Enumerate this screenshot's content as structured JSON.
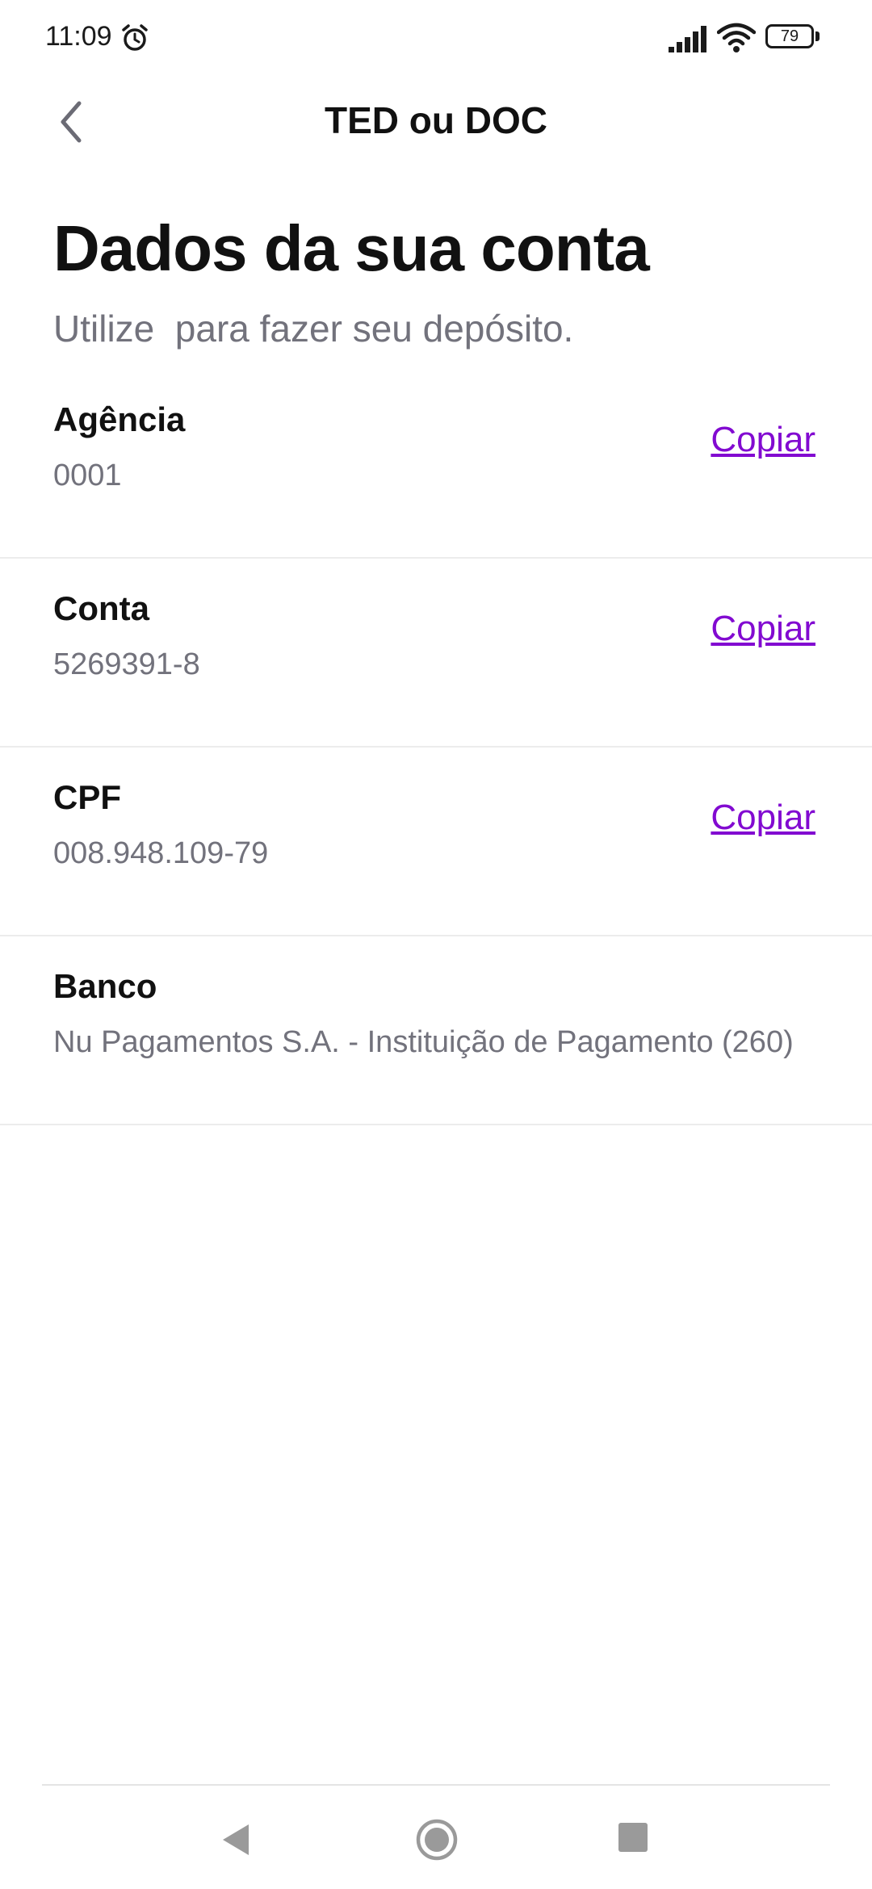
{
  "status_bar": {
    "time": "11:09",
    "battery_level": "79",
    "icons": [
      "alarm-icon",
      "signal-icon",
      "wifi-icon",
      "battery-icon"
    ]
  },
  "header": {
    "title": "TED ou DOC",
    "back_icon": "chevron-left-icon"
  },
  "main": {
    "title": "Dados da sua conta",
    "subtitle": "Utilize  para fazer seu depósito.",
    "copy_label": "Copiar",
    "rows": [
      {
        "label": "Agência",
        "value": "0001",
        "copyable": true
      },
      {
        "label": "Conta",
        "value": "5269391-8",
        "copyable": true
      },
      {
        "label": "CPF",
        "value": "008.948.109-79",
        "copyable": true
      },
      {
        "label": "Banco",
        "value": "Nu Pagamentos S.A. - Instituição de Pagamento (260)",
        "copyable": false
      }
    ]
  },
  "nav_bar": {
    "icons": [
      "nav-back-icon",
      "nav-home-icon",
      "nav-recents-icon"
    ]
  },
  "colors": {
    "accent": "#820ad1",
    "secondary_text": "#72727c",
    "divider": "#ececec"
  }
}
